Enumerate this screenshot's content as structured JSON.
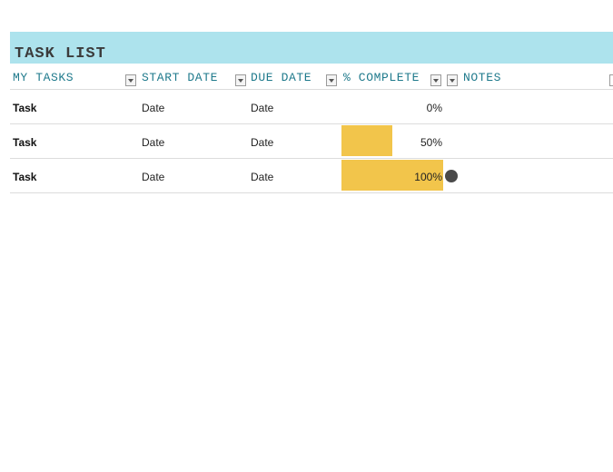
{
  "title": "TASK LIST",
  "headers": {
    "my_tasks": "MY TASKS",
    "start_date": "START DATE",
    "due_date": "DUE DATE",
    "complete": "% COMPLETE",
    "notes": "NOTES"
  },
  "rows": [
    {
      "task": "Task",
      "start": "Date",
      "due": "Date",
      "pct_label": "0%",
      "pct": 0
    },
    {
      "task": "Task",
      "start": "Date",
      "due": "Date",
      "pct_label": "50%",
      "pct": 50
    },
    {
      "task": "Task",
      "start": "Date",
      "due": "Date",
      "pct_label": "100%",
      "pct": 100
    }
  ],
  "colors": {
    "title_band": "#ade3ed",
    "header_text": "#1f7a8c",
    "bar_fill": "#f2c54b"
  },
  "icons": [
    "filter-dropdown-icon",
    "complete-indicator-icon"
  ]
}
